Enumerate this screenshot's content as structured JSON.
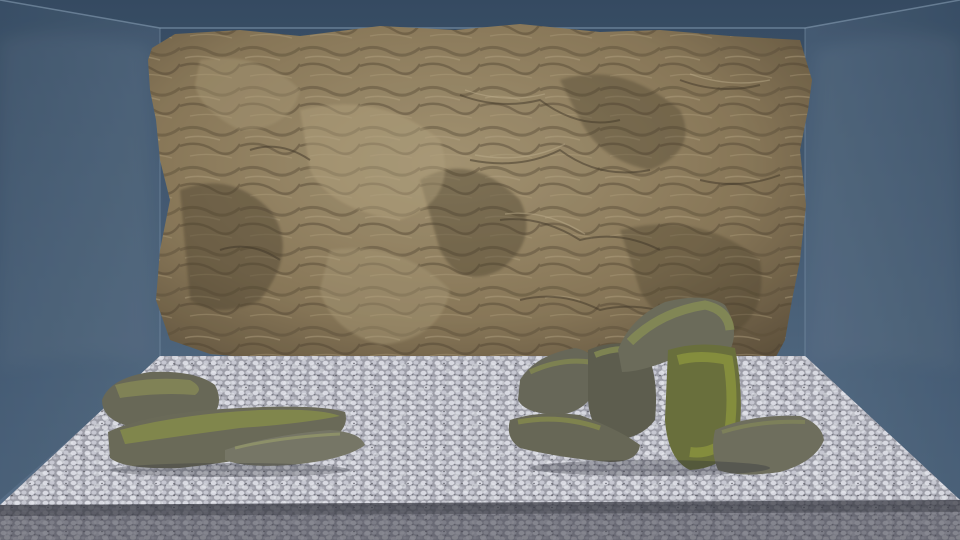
{
  "scene": {
    "subject": "aquarium-background-rock-and-gravel-render",
    "colors": {
      "water_top": "#3b5068",
      "water_bottom": "#4f6880",
      "rock_light": "#a48f69",
      "rock_mid": "#7f6c4c",
      "rock_dark": "#3e3323",
      "gravel_light": "#d9d8de",
      "gravel_dark": "#5b5a63",
      "moss": "#8a9037",
      "stone_grey": "#6c6a58"
    }
  }
}
